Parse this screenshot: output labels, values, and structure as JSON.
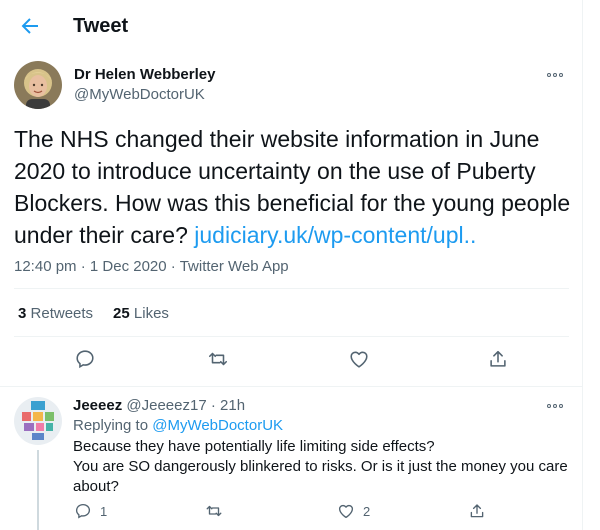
{
  "header": {
    "title": "Tweet",
    "back_icon": "arrow-left-icon"
  },
  "main_tweet": {
    "author_name": "Dr Helen Webberley",
    "author_handle": "@MyWebDoctorUK",
    "text": "The NHS changed their website information in June 2020 to introduce uncertainty on the use of Puberty Blockers. How was this beneficial for the young people under their care?",
    "link_text": "judiciary.uk/wp-content/upl..",
    "time": "12:40 pm",
    "date": "1 Dec 2020",
    "source": "Twitter Web App",
    "retweets_count": "3",
    "retweets_label": "Retweets",
    "likes_count": "25",
    "likes_label": "Likes"
  },
  "reply": {
    "author_name": "Jeeeez",
    "author_handle": "@Jeeeez17",
    "time_ago": "21h",
    "replying_to_label": "Replying to",
    "replying_to_handle": "@MyWebDoctorUK",
    "line1": "Because they have potentially life limiting side effects?",
    "line2": "You are SO dangerously blinkered to risks. Or is it just the money you care about?",
    "reply_count": "1",
    "retweet_count": "",
    "like_count": "2"
  },
  "colors": {
    "accent": "#1d9bf0",
    "muted": "#536471",
    "text": "#0f1419",
    "divider": "#eff3f4"
  }
}
